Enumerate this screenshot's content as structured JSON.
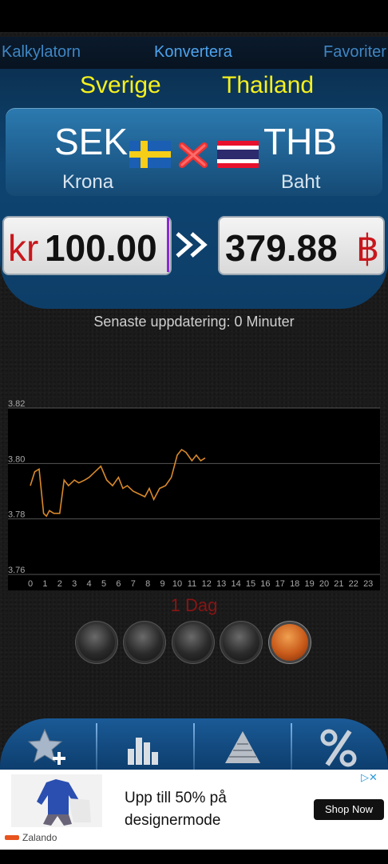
{
  "tabs": [
    "Kalkylatorn",
    "Konvertera",
    "Favoriter"
  ],
  "from": {
    "country": "Sverige",
    "code": "SEK",
    "name": "Krona",
    "symbol": "kr",
    "amount": "100.00"
  },
  "to": {
    "country": "Thailand",
    "code": "THB",
    "name": "Baht",
    "symbol": "฿",
    "amount": "379.88"
  },
  "updated": "Senaste uppdatering: 0 Minuter",
  "range_label": "1 Dag",
  "chart_data": {
    "type": "line",
    "title": "",
    "xlabel": "",
    "ylabel": "",
    "x_ticks": [
      "0",
      "1",
      "2",
      "3",
      "4",
      "5",
      "6",
      "7",
      "8",
      "9",
      "10",
      "11",
      "12",
      "13",
      "14",
      "15",
      "16",
      "17",
      "18",
      "19",
      "20",
      "21",
      "22",
      "23"
    ],
    "y_ticks": [
      "3.76",
      "3.78",
      "3.80",
      "3.82"
    ],
    "xlim": [
      0,
      24
    ],
    "ylim": [
      3.76,
      3.82
    ],
    "grid": true,
    "line_color": "#d9892a",
    "series": [
      {
        "x": [
          0,
          0.3,
          0.6,
          0.9,
          1.1,
          1.3,
          1.6,
          2.0,
          2.3,
          2.6,
          3.0,
          3.3,
          3.7,
          4.0,
          4.4,
          4.8,
          5.2,
          5.6,
          6.0,
          6.3,
          6.6,
          7.0,
          7.4,
          7.8,
          8.1,
          8.4,
          8.8,
          9.2,
          9.6,
          10.0,
          10.3,
          10.6,
          11.0,
          11.3,
          11.6,
          11.9
        ],
        "values": [
          3.792,
          3.797,
          3.798,
          3.782,
          3.781,
          3.783,
          3.782,
          3.782,
          3.794,
          3.792,
          3.794,
          3.793,
          3.794,
          3.795,
          3.797,
          3.799,
          3.794,
          3.792,
          3.795,
          3.791,
          3.792,
          3.79,
          3.789,
          3.788,
          3.791,
          3.787,
          3.791,
          3.792,
          3.795,
          3.803,
          3.805,
          3.804,
          3.801,
          3.803,
          3.801,
          3.802
        ]
      }
    ]
  },
  "ad": {
    "headline": "Upp till 50% på designermode",
    "button": "Shop Now",
    "brand": "Zalando"
  },
  "colors": {
    "accent": "#4da3ee",
    "country": "#f5f01e",
    "symbol": "#c8171c"
  }
}
